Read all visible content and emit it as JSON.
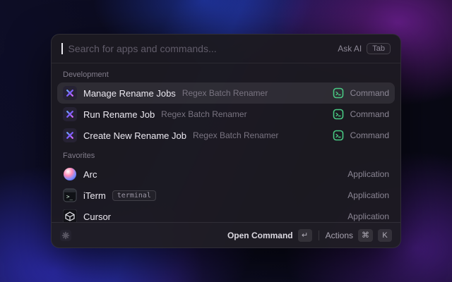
{
  "launcher": {
    "search": {
      "placeholder": "Search for apps and commands...",
      "ask_ai_label": "Ask AI",
      "ask_ai_key": "Tab"
    },
    "sections": [
      {
        "title": "Development",
        "items": [
          {
            "title": "Manage Rename Jobs",
            "subtitle": "Regex Batch Renamer",
            "type": "Command",
            "icon": "pinwheel-extension-icon",
            "selected": true
          },
          {
            "title": "Run Rename Job",
            "subtitle": "Regex Batch Renamer",
            "type": "Command",
            "icon": "pinwheel-extension-icon"
          },
          {
            "title": "Create New Rename Job",
            "subtitle": "Regex Batch Renamer",
            "type": "Command",
            "icon": "pinwheel-extension-icon"
          }
        ]
      },
      {
        "title": "Favorites",
        "items": [
          {
            "title": "Arc",
            "type": "Application",
            "icon": "arc-browser-icon"
          },
          {
            "title": "iTerm",
            "badge": "terminal",
            "type": "Application",
            "icon": "iterm-icon"
          },
          {
            "title": "Cursor",
            "type": "Application",
            "icon": "cursor-icon"
          }
        ]
      }
    ],
    "footer": {
      "primary_label": "Open Command",
      "primary_key": "↵",
      "actions_label": "Actions",
      "actions_key_1": "⌘",
      "actions_key_2": "K"
    },
    "icons": {
      "command_type": "terminal-green-icon",
      "footer_left": "pinwheel-extension-icon"
    },
    "colors": {
      "command_green": "#49c983",
      "selection_highlight": "rgba(255,255,255,0.085)",
      "window_background": "#1c1a21"
    }
  }
}
